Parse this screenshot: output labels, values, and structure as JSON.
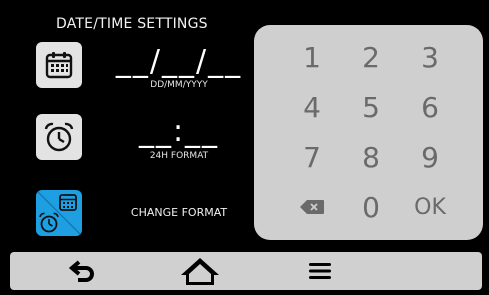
{
  "title": "DATE/TIME SETTINGS",
  "date": {
    "value": "__/__/__",
    "caption": "DD/MM/YYYY",
    "icon": "calendar-icon"
  },
  "time": {
    "value": "__:__",
    "caption": "24H FORMAT",
    "icon": "alarm-clock-icon"
  },
  "format": {
    "label": "CHANGE FORMAT",
    "icon": "calendar-clock-icon",
    "accent": "#1e9fe2"
  },
  "keypad": {
    "keys": [
      "1",
      "2",
      "3",
      "4",
      "5",
      "6",
      "7",
      "8",
      "9",
      "backspace",
      "0",
      "OK"
    ],
    "key_color": "#6a6a6a",
    "background": "#cfcfcf"
  },
  "bottombar": {
    "items": [
      "back-arrow-icon",
      "home-icon",
      "menu-icon"
    ]
  }
}
